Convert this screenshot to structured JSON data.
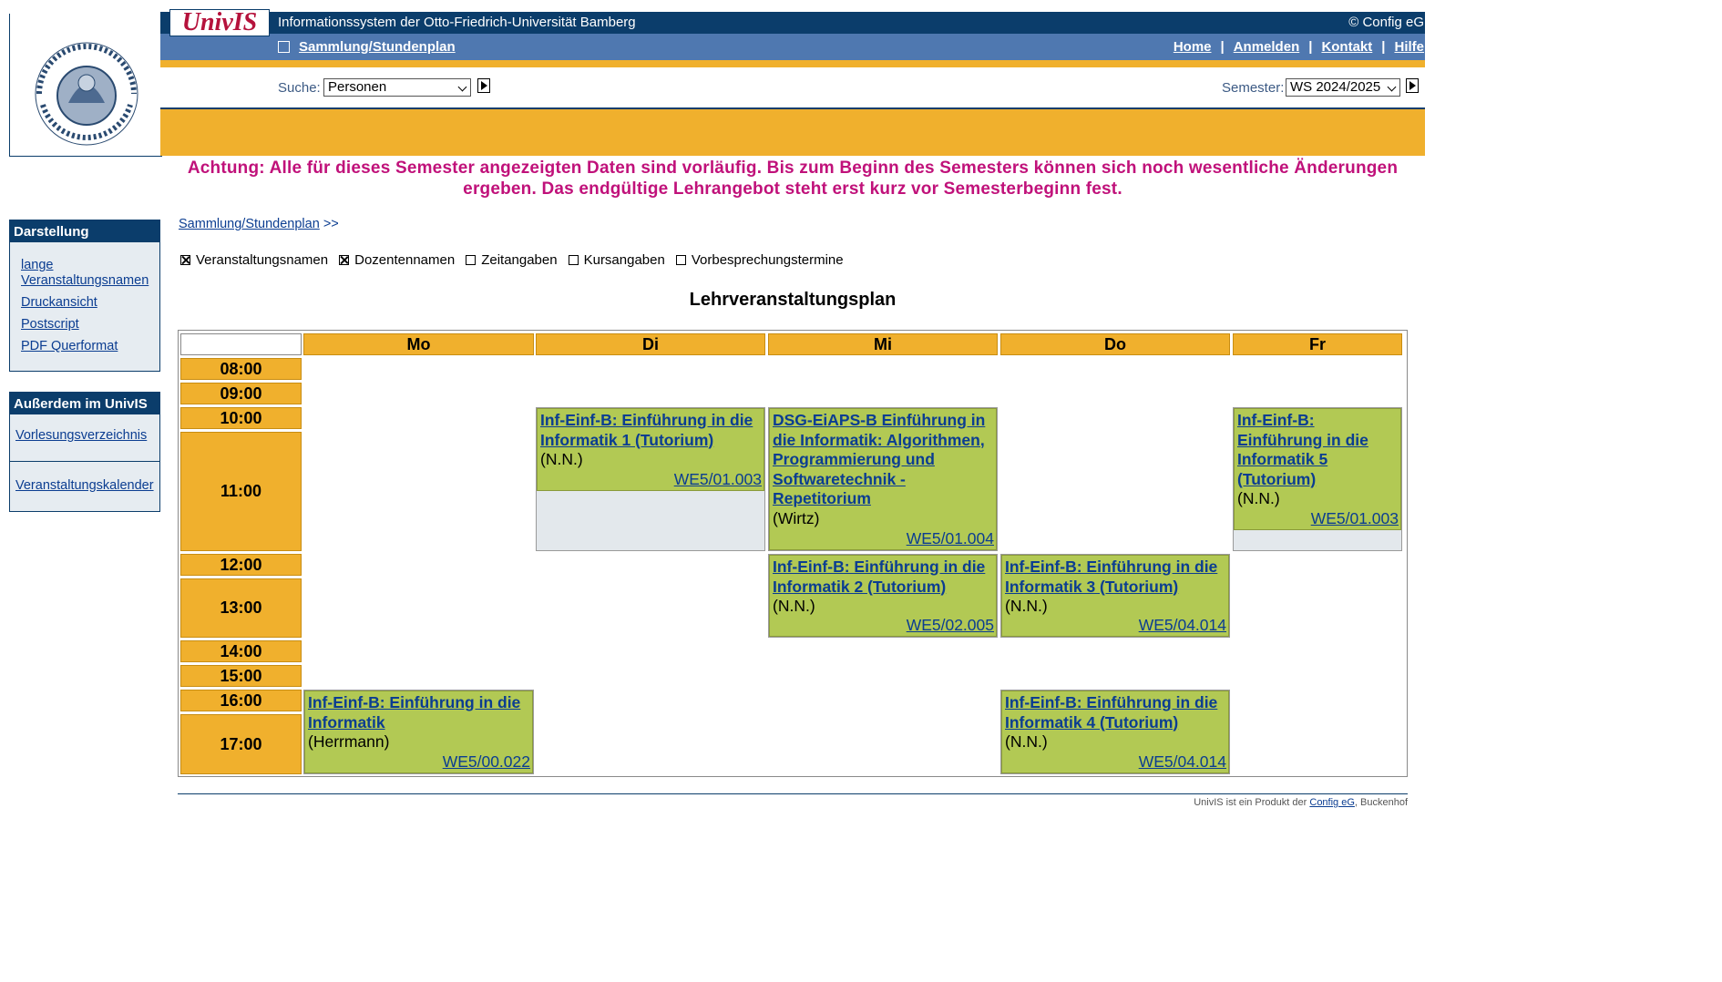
{
  "header": {
    "logo_text": "UnivIS",
    "system_title": "Informationssystem der Otto-Friedrich-Universität Bamberg",
    "copyright": "© Config eG",
    "nav_crumb": "Sammlung/Stundenplan",
    "links": [
      "Home",
      "Anmelden",
      "Kontakt",
      "Hilfe"
    ],
    "uni_seal_text": "OTTO-FRIEDRICH-UNIVERSITÄT BAMBERG"
  },
  "search": {
    "label": "Suche:",
    "selected": "Personen",
    "semester_label": "Semester:",
    "semester_selected": "WS 2024/2025"
  },
  "warning": "Achtung: Alle für dieses Semester angezeigten Daten sind vorläufig. Bis zum Beginn des Semesters können sich noch wesentliche Änderungen ergeben. Das endgültige Lehrangebot steht erst kurz vor Semesterbeginn fest.",
  "sidebar": {
    "darstellung_title": "Darstellung",
    "darstellung_links": [
      "lange Veranstaltungsnamen",
      "Druckansicht",
      "Postscript",
      "PDF Querformat"
    ],
    "ausserdem_title": "Außerdem im UnivIS",
    "ausserdem_links": [
      "Vorlesungsverzeichnis",
      "Veranstaltungskalender"
    ]
  },
  "main": {
    "breadcrumb_link": "Sammlung/Stundenplan",
    "breadcrumb_sep": ">>",
    "options": [
      {
        "label": "Veranstaltungsnamen",
        "checked": true
      },
      {
        "label": "Dozentennamen",
        "checked": true
      },
      {
        "label": "Zeitangaben",
        "checked": false
      },
      {
        "label": "Kursangaben",
        "checked": false
      },
      {
        "label": "Vorbesprechungstermine",
        "checked": false
      }
    ],
    "plan_title": "Lehrveranstaltungsplan",
    "days": [
      "Mo",
      "Di",
      "Mi",
      "Do",
      "Fr"
    ],
    "times": [
      "08:00",
      "09:00",
      "10:00",
      "11:00",
      "12:00",
      "13:00",
      "14:00",
      "15:00",
      "16:00",
      "17:00"
    ],
    "events": [
      {
        "title": "Inf-Einf-B: Einführung in die Informatik 1 (Tutorium)",
        "lecturer": "(N.N.)",
        "room": "WE5/01.003"
      },
      {
        "title": "DSG-EiAPS-B Einführung in die Informatik: Algorithmen, Programmierung und Softwaretechnik - Repetitorium",
        "lecturer": "(Wirtz)",
        "room": "WE5/01.004"
      },
      {
        "title": "Inf-Einf-B: Einführung in die Informatik 5 (Tutorium)",
        "lecturer": "(N.N.)",
        "room": "WE5/01.003"
      },
      {
        "title": "Inf-Einf-B: Einführung in die Informatik 2 (Tutorium)",
        "lecturer": "(N.N.)",
        "room": "WE5/02.005"
      },
      {
        "title": "Inf-Einf-B: Einführung in die Informatik 3 (Tutorium)",
        "lecturer": "(N.N.)",
        "room": "WE5/04.014"
      },
      {
        "title": "Inf-Einf-B: Einführung in die Informatik",
        "lecturer": "(Herrmann)",
        "room": "WE5/00.022"
      },
      {
        "title": "Inf-Einf-B: Einführung in die Informatik 4 (Tutorium)",
        "lecturer": "(N.N.)",
        "room": "WE5/04.014"
      }
    ]
  },
  "footer": {
    "text_before": "UnivIS ist ein Produkt der",
    "link": "Config eG",
    "text_after": ", Buckenhof"
  },
  "colors": {
    "navy": "#0b3d6b",
    "nav_blue": "#4f78b0",
    "orange": "#f0b02d",
    "event_green": "#b2c954",
    "warning_magenta": "#c0117a"
  }
}
